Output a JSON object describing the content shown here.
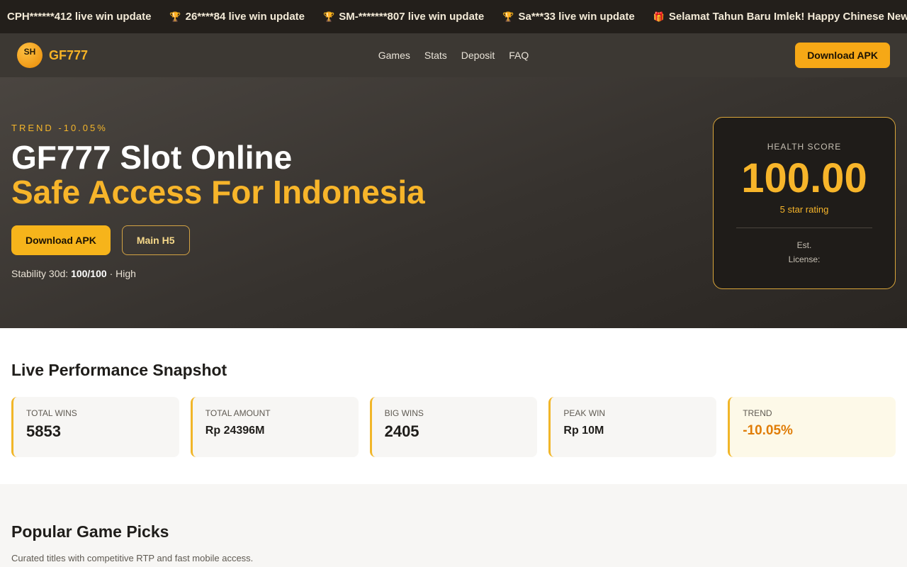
{
  "ticker": [
    {
      "icon": "",
      "text": "CPH******412 live win update"
    },
    {
      "icon": "🏆",
      "text": "26****84 live win update"
    },
    {
      "icon": "🏆",
      "text": "SM-*******807 live win update"
    },
    {
      "icon": "🏆",
      "text": "Sa***33 live win update"
    },
    {
      "icon": "🎁",
      "text": "Selamat Tahun Baru Imlek! Happy Chinese New Year Bo"
    }
  ],
  "header": {
    "logo_badge": "SH",
    "logo_text": "GF777",
    "nav": [
      "Games",
      "Stats",
      "Deposit",
      "FAQ"
    ],
    "download_label": "Download APK"
  },
  "hero": {
    "trend": "TREND -10.05%",
    "title_main": "GF777 Slot Online",
    "title_sub": "Safe Access For Indonesia",
    "primary_label": "Download APK",
    "secondary_label": "Main H5",
    "stability_prefix": "Stability 30d:",
    "stability_value": "100/100",
    "stability_suffix": "· High"
  },
  "health": {
    "label": "HEALTH SCORE",
    "score": "100.00",
    "rating": "5 star rating",
    "est": "Est.",
    "license": "License:"
  },
  "stats": {
    "title": "Live Performance Snapshot",
    "cards": [
      {
        "label": "TOTAL WINS",
        "value": "5853"
      },
      {
        "label": "TOTAL AMOUNT",
        "value": "Rp 24396M"
      },
      {
        "label": "BIG WINS",
        "value": "2405"
      },
      {
        "label": "PEAK WIN",
        "value": "Rp 10M"
      },
      {
        "label": "TREND",
        "value": "-10.05%"
      }
    ]
  },
  "popular": {
    "title": "Popular Game Picks",
    "subtitle": "Curated titles with competitive RTP and fast mobile access."
  },
  "colors": {
    "accent": "#f6b41b",
    "dark": "#231f1b",
    "trend": "#e07d08"
  }
}
